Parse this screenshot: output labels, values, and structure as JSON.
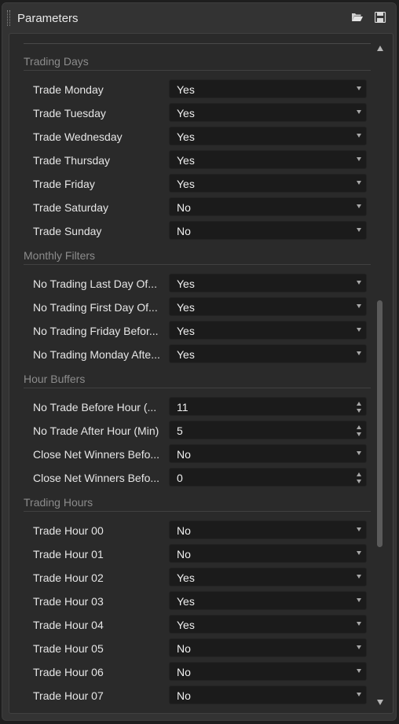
{
  "panel": {
    "title": "Parameters",
    "icons": [
      "folder-open-icon",
      "save-icon"
    ]
  },
  "sections": {
    "trading_days": {
      "title": "Trading Days",
      "rows": [
        {
          "label": "Trade Monday",
          "value": "Yes"
        },
        {
          "label": "Trade Tuesday",
          "value": "Yes"
        },
        {
          "label": "Trade Wednesday",
          "value": "Yes"
        },
        {
          "label": "Trade Thursday",
          "value": "Yes"
        },
        {
          "label": "Trade Friday",
          "value": "Yes"
        },
        {
          "label": "Trade Saturday",
          "value": "No"
        },
        {
          "label": "Trade Sunday",
          "value": "No"
        }
      ]
    },
    "monthly_filters": {
      "title": "Monthly Filters",
      "rows": [
        {
          "label": "No Trading Last Day Of...",
          "value": "Yes"
        },
        {
          "label": "No Trading First Day Of...",
          "value": "Yes"
        },
        {
          "label": "No Trading Friday Befor...",
          "value": "Yes"
        },
        {
          "label": "No Trading Monday Afte...",
          "value": "Yes"
        }
      ]
    },
    "hour_buffers": {
      "title": "Hour Buffers",
      "rows": [
        {
          "label": "No Trade Before Hour (...",
          "value": "11"
        },
        {
          "label": "No Trade After Hour (Min)",
          "value": "5"
        },
        {
          "label": "Close Net Winners Befo...",
          "value": "No"
        },
        {
          "label": "Close Net Winners Befo...",
          "value": "0"
        }
      ]
    },
    "trading_hours": {
      "title": "Trading Hours",
      "rows": [
        {
          "label": "Trade Hour 00",
          "value": "No"
        },
        {
          "label": "Trade Hour 01",
          "value": "No"
        },
        {
          "label": "Trade Hour 02",
          "value": "Yes"
        },
        {
          "label": "Trade Hour 03",
          "value": "Yes"
        },
        {
          "label": "Trade Hour 04",
          "value": "Yes"
        },
        {
          "label": "Trade Hour 05",
          "value": "No"
        },
        {
          "label": "Trade Hour 06",
          "value": "No"
        },
        {
          "label": "Trade Hour 07",
          "value": "No"
        }
      ]
    }
  }
}
